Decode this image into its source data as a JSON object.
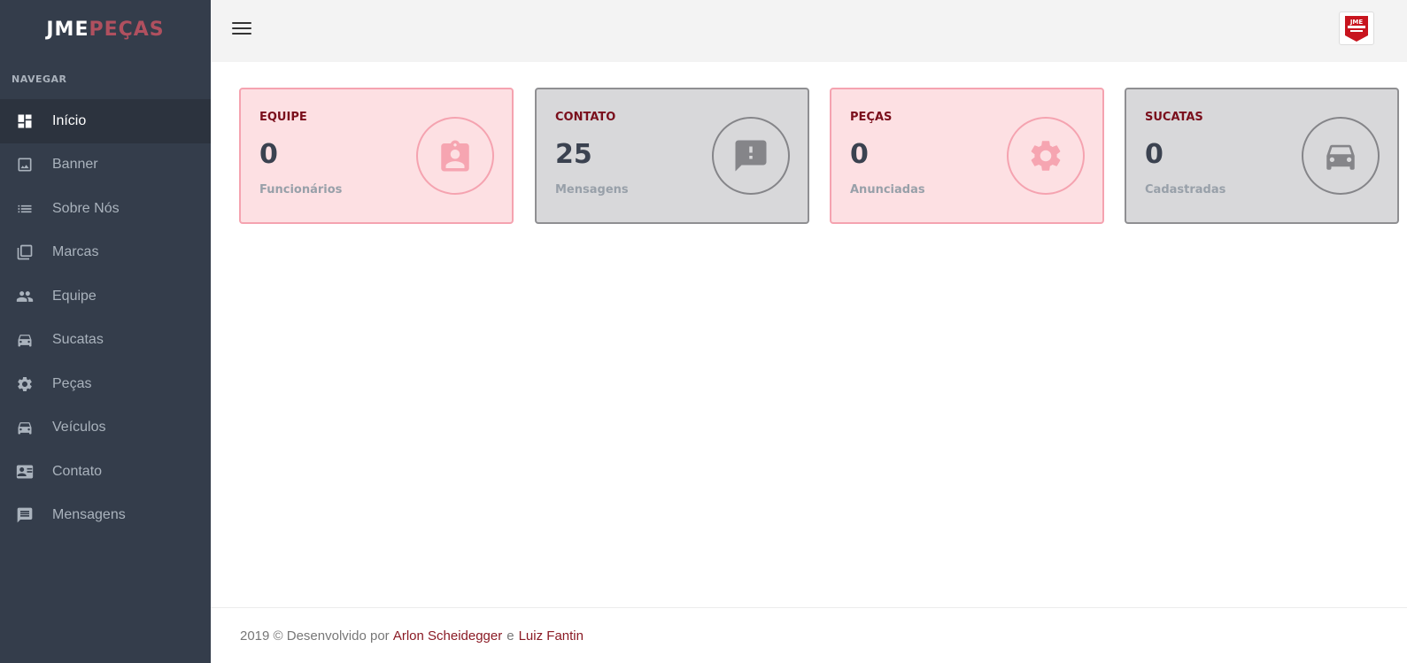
{
  "brand": {
    "part1": "JME",
    "part2": "PEÇAS"
  },
  "nav": {
    "heading": "NAVEGAR",
    "items": [
      {
        "label": "Início",
        "icon": "dashboard-icon"
      },
      {
        "label": "Banner",
        "icon": "image-icon"
      },
      {
        "label": "Sobre Nós",
        "icon": "list-icon"
      },
      {
        "label": "Marcas",
        "icon": "library-icon"
      },
      {
        "label": "Equipe",
        "icon": "people-icon"
      },
      {
        "label": "Sucatas",
        "icon": "car-icon"
      },
      {
        "label": "Peças",
        "icon": "gear-icon"
      },
      {
        "label": "Veículos",
        "icon": "car-icon"
      },
      {
        "label": "Contato",
        "icon": "contact-card-icon"
      },
      {
        "label": "Mensagens",
        "icon": "message-icon"
      }
    ]
  },
  "header": {
    "logo_text": "JME COMÉRCIO DE PEÇAS"
  },
  "cards": [
    {
      "title": "EQUIPE",
      "value": "0",
      "subtitle": "Funcionários",
      "icon": "badge-icon",
      "style": "pink"
    },
    {
      "title": "CONTATO",
      "value": "25",
      "subtitle": "Mensagens",
      "icon": "feedback-icon",
      "style": "gray"
    },
    {
      "title": "PEÇAS",
      "value": "0",
      "subtitle": "Anunciadas",
      "icon": "gear-icon",
      "style": "pink"
    },
    {
      "title": "SUCATAS",
      "value": "0",
      "subtitle": "Cadastradas",
      "icon": "car-icon",
      "style": "gray"
    }
  ],
  "footer": {
    "prefix": "2019 © Desenvolvido por",
    "author1": "Arlon Scheidegger",
    "separator": "e",
    "author2": "Luiz Fantin"
  },
  "colors": {
    "sidebar_bg": "#343d4b",
    "accent_dark_red": "#7a0f1c",
    "pink_card_bg": "#fde0e3",
    "gray_card_bg": "#d8d8da"
  }
}
